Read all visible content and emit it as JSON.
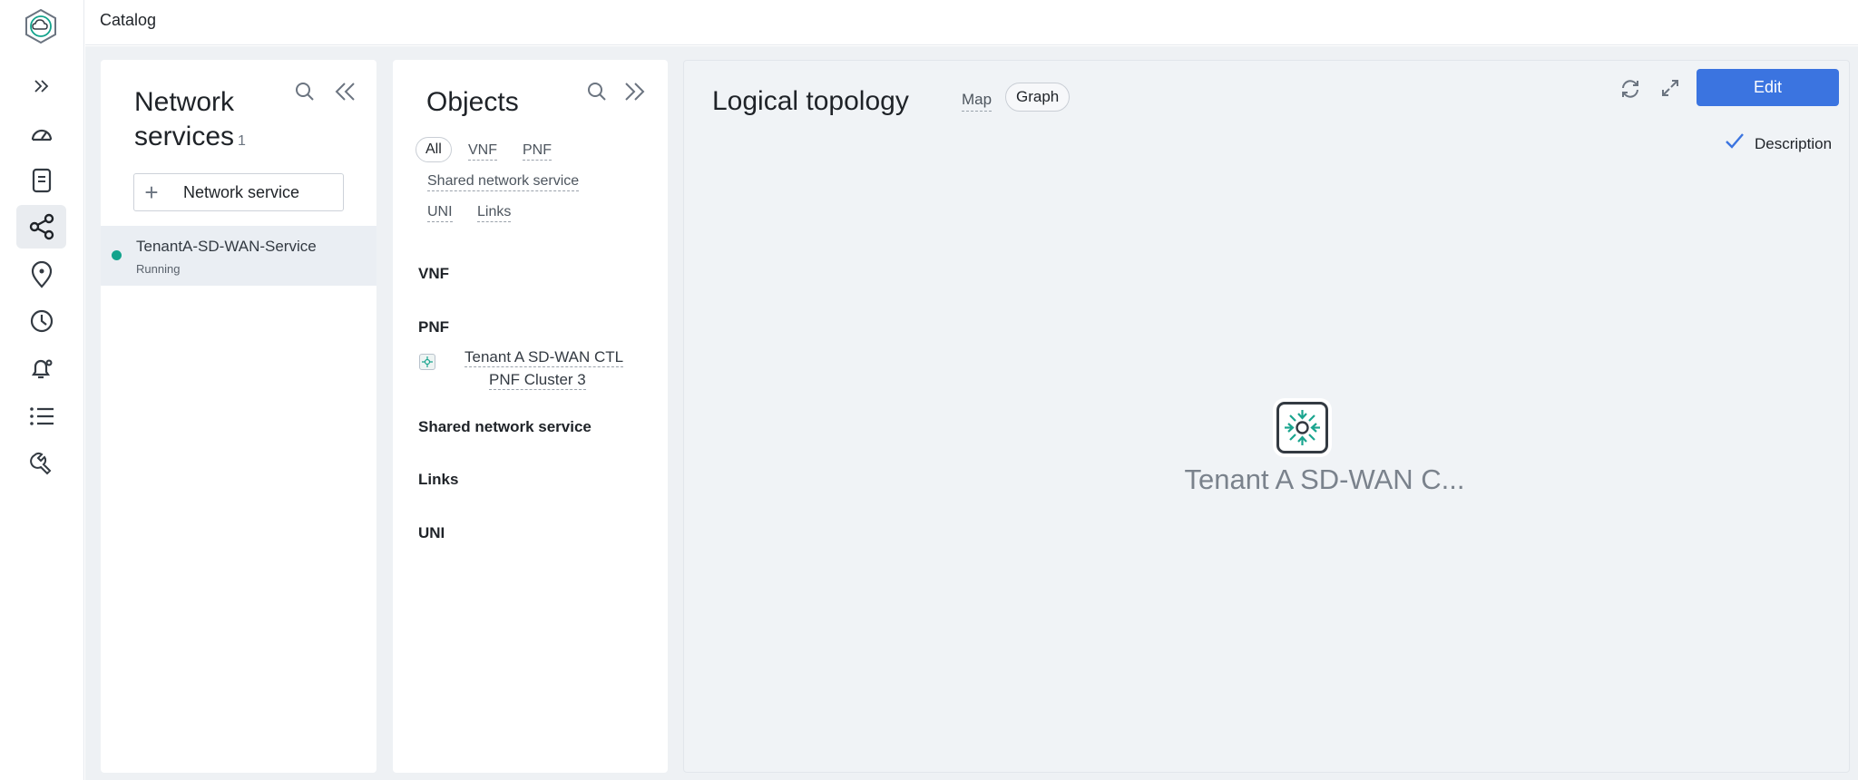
{
  "topbar": {
    "breadcrumb": "Catalog"
  },
  "rail": {
    "items": [
      {
        "name": "expand",
        "icon": "chevrons-right-icon"
      },
      {
        "name": "dashboard",
        "icon": "gauge-icon"
      },
      {
        "name": "documents",
        "icon": "document-icon"
      },
      {
        "name": "network-services",
        "icon": "share-nodes-icon",
        "active": true
      },
      {
        "name": "locations",
        "icon": "map-pin-icon"
      },
      {
        "name": "history",
        "icon": "clock-icon"
      },
      {
        "name": "alerts",
        "icon": "bell-gear-icon"
      },
      {
        "name": "list",
        "icon": "list-icon"
      },
      {
        "name": "tools",
        "icon": "wrench-icon"
      }
    ]
  },
  "network_services": {
    "title": "Network services",
    "count": "1",
    "add_label": "Network service",
    "items": [
      {
        "name": "TenantA-SD-WAN-Service",
        "status": "Running",
        "status_color": "#13a38c"
      }
    ]
  },
  "objects": {
    "title": "Objects",
    "filters": {
      "all": "All",
      "vnf": "VNF",
      "pnf": "PNF",
      "shared": "Shared network service",
      "uni": "UNI",
      "links": "Links"
    },
    "sections": {
      "vnf": "VNF",
      "pnf": "PNF",
      "shared": "Shared network service",
      "links": "Links",
      "uni": "UNI"
    },
    "pnf_item": {
      "line1": "Tenant A SD-WAN CTL",
      "line2": "PNF Cluster 3"
    }
  },
  "topology": {
    "title": "Logical topology",
    "tab_map": "Map",
    "tab_graph": "Graph",
    "edit_label": "Edit",
    "description_label": "Description",
    "description_checked": true,
    "node_label": "Tenant A SD-WAN C..."
  },
  "colors": {
    "accent": "#3b74e0",
    "running": "#13a38c",
    "node_icon": "#1aa58f"
  }
}
